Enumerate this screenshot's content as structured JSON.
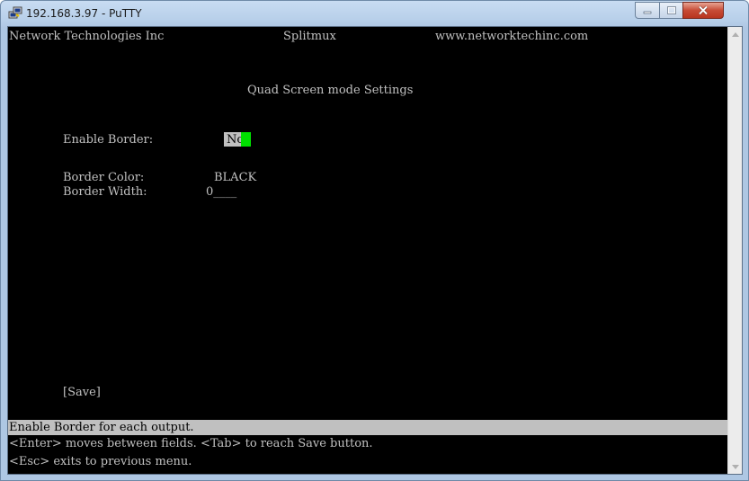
{
  "window": {
    "title": "192.168.3.97 - PuTTY"
  },
  "icons": {
    "app": "putty-icon",
    "minimize": "minimize-icon",
    "maximize": "maximize-icon",
    "close": "close-icon",
    "scroll_up": "scroll-up-arrow-icon",
    "scroll_down": "scroll-down-arrow-icon"
  },
  "terminal": {
    "header": {
      "company": "Network Technologies Inc",
      "product": "Splitmux",
      "website": "www.networktechinc.com"
    },
    "screen_title": "Quad Screen mode Settings",
    "fields": {
      "enable_border_label": "Enable Border:",
      "enable_border_value": "No",
      "border_color_label": "Border Color:",
      "border_color_value": "BLACK",
      "border_width_label": "Border Width:",
      "border_width_value": "0____"
    },
    "save_button": "[Save]",
    "status_line": "Enable Border for each output.",
    "help_line_1": "<Enter> moves between fields. <Tab> to reach Save button.",
    "help_line_2": "<Esc> exits to previous menu."
  },
  "colors": {
    "background": "#000000",
    "foreground": "#c0c0c0",
    "cursor": "#00e000",
    "status_bar": "#c0c0c0"
  }
}
